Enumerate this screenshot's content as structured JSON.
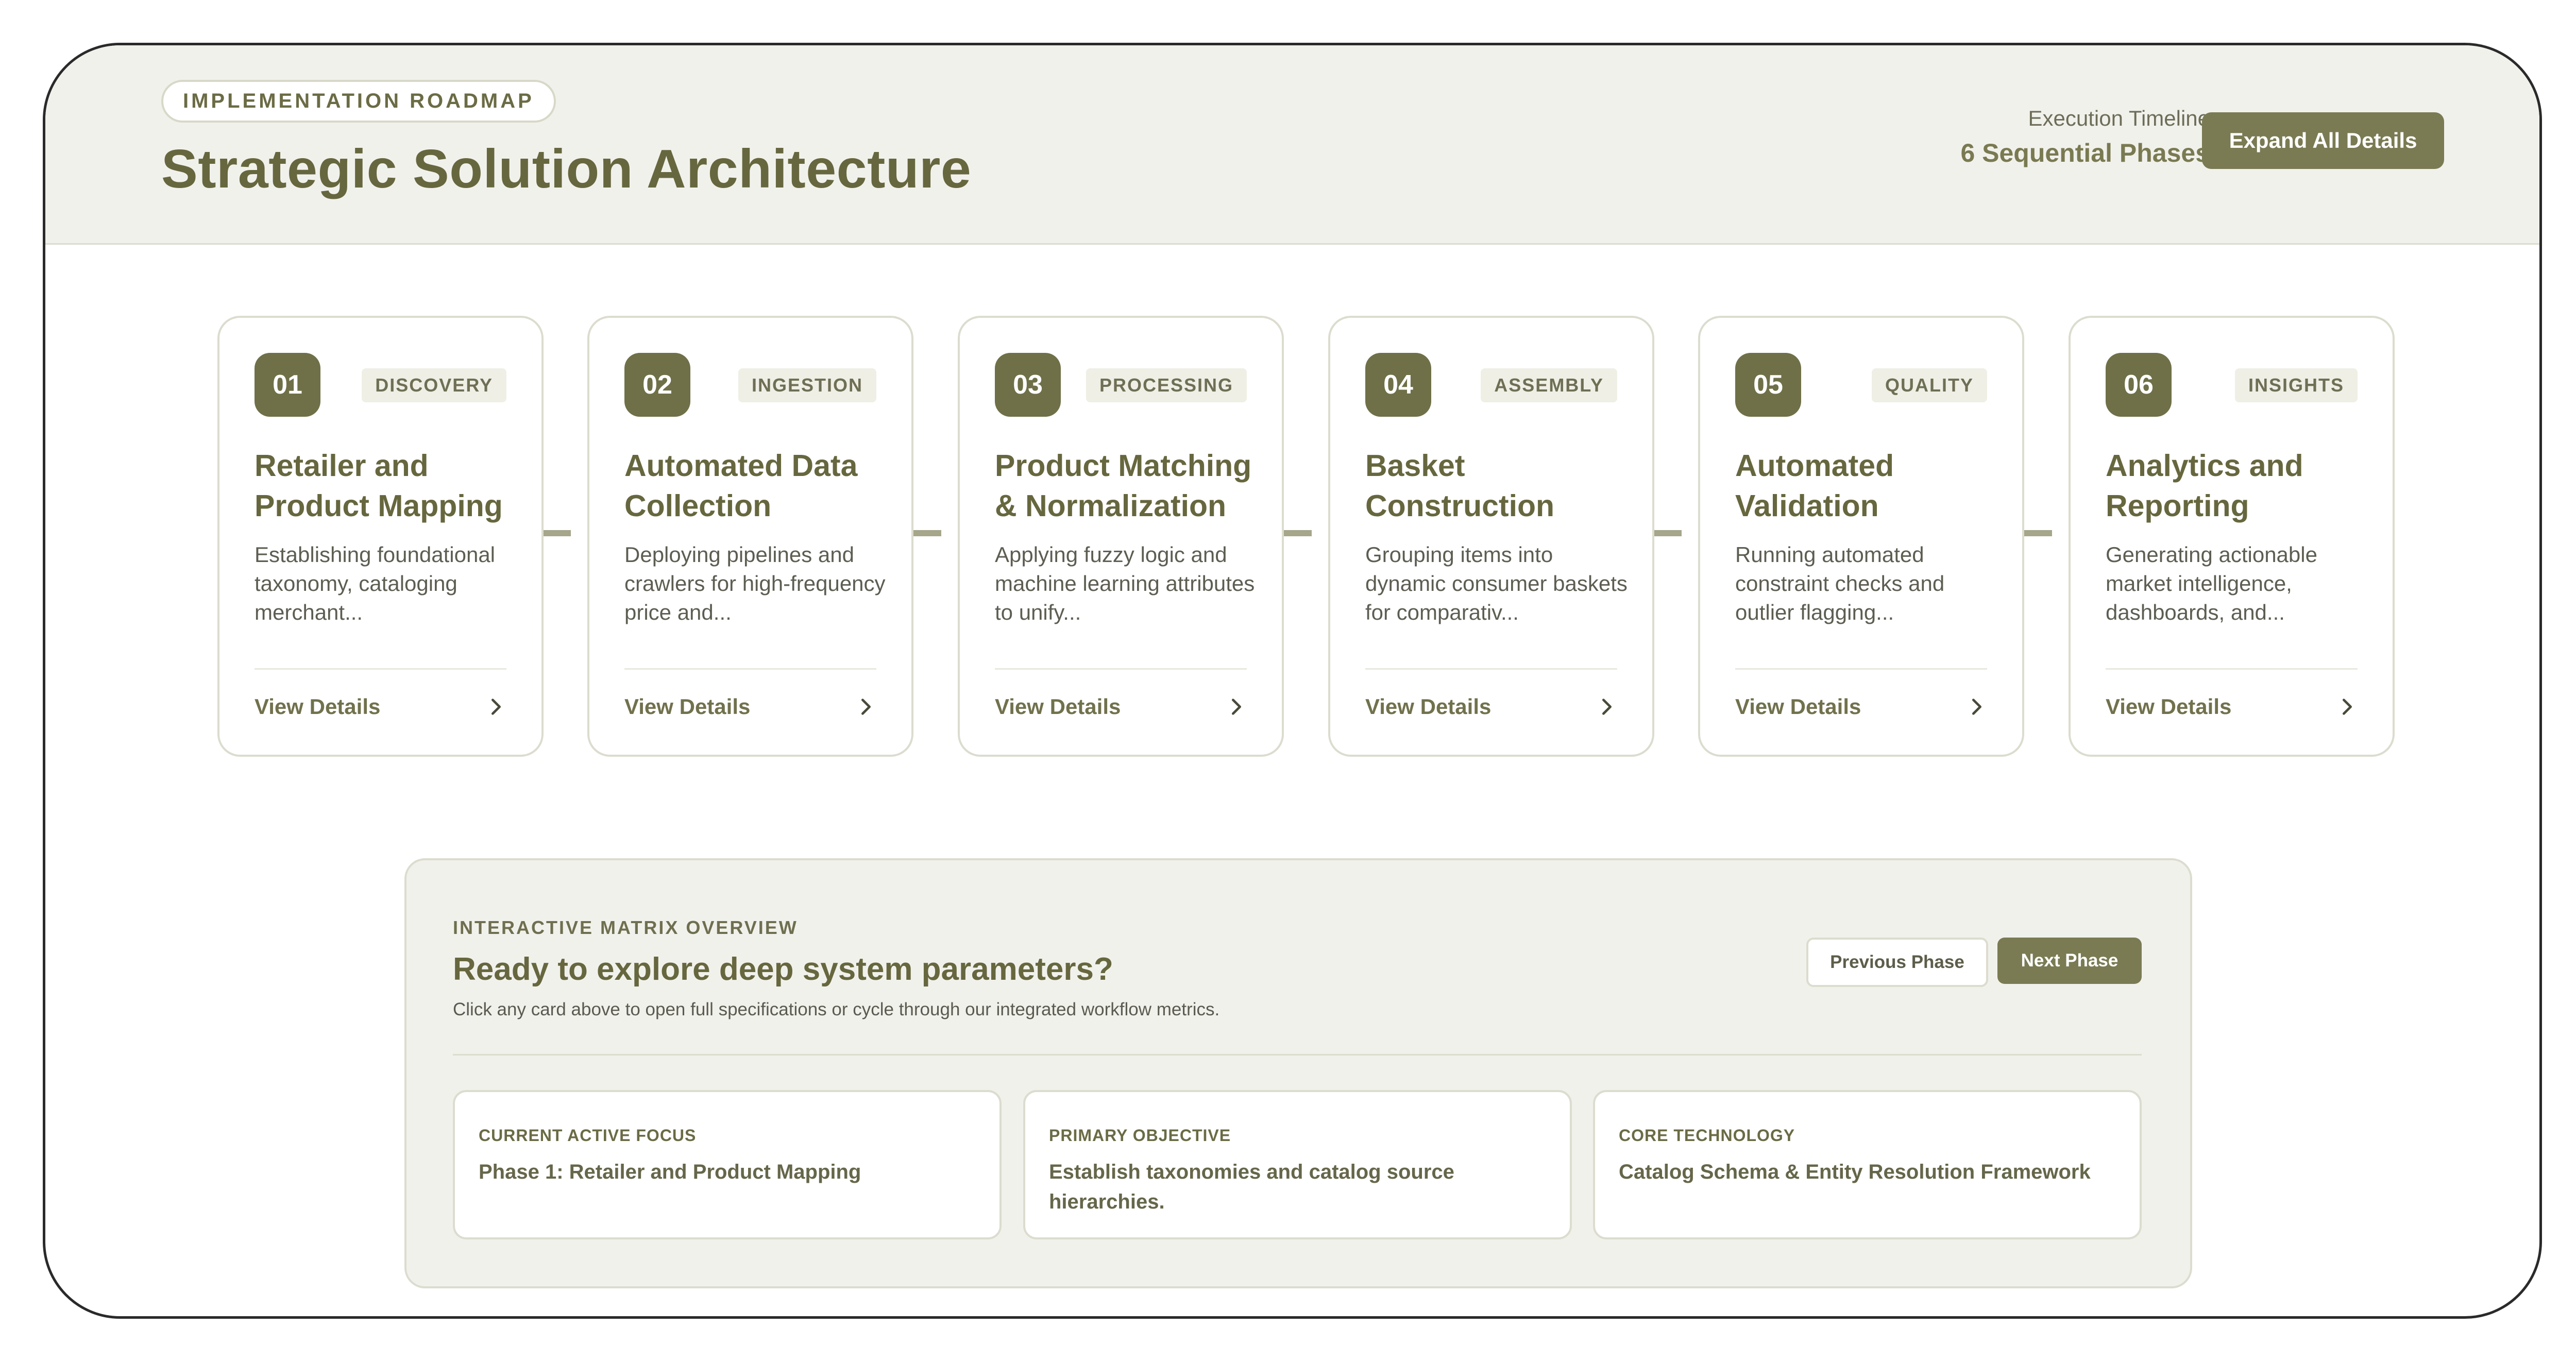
{
  "header": {
    "eyebrow": "IMPLEMENTATION ROADMAP",
    "title": "Strategic Solution Architecture",
    "timeline_label": "Execution Timeline",
    "timeline_value": "6 Sequential Phases",
    "expand_button": "Expand All Details"
  },
  "phases": [
    {
      "number": "01",
      "tag": "DISCOVERY",
      "title": "Retailer and Product Mapping",
      "description": "Establishing foundational taxonomy, cataloging merchant...",
      "link": "View Details"
    },
    {
      "number": "02",
      "tag": "INGESTION",
      "title": "Automated Data Collection",
      "description": "Deploying pipelines and crawlers for high-frequency price and...",
      "link": "View Details"
    },
    {
      "number": "03",
      "tag": "PROCESSING",
      "title": "Product Matching & Normalization",
      "description": "Applying fuzzy logic and machine learning attributes to unify...",
      "link": "View Details"
    },
    {
      "number": "04",
      "tag": "ASSEMBLY",
      "title": "Basket Construction",
      "description": "Grouping items into dynamic consumer baskets for comparativ...",
      "link": "View Details"
    },
    {
      "number": "05",
      "tag": "QUALITY",
      "title": "Automated Validation",
      "description": "Running automated constraint checks and outlier flagging...",
      "link": "View Details"
    },
    {
      "number": "06",
      "tag": "INSIGHTS",
      "title": "Analytics and Reporting",
      "description": "Generating actionable market intelligence, dashboards, and...",
      "link": "View Details"
    }
  ],
  "matrix": {
    "eyebrow": "INTERACTIVE MATRIX OVERVIEW",
    "title": "Ready to explore deep system parameters?",
    "subtitle": "Click any card above to open full specifications or cycle through our integrated workflow metrics.",
    "prev_button": "Previous Phase",
    "next_button": "Next Phase",
    "cards": [
      {
        "label": "CURRENT ACTIVE FOCUS",
        "value": "Phase 1: Retailer and Product Mapping"
      },
      {
        "label": "PRIMARY OBJECTIVE",
        "value": "Establish taxonomies and catalog source hierarchies."
      },
      {
        "label": "CORE TECHNOLOGY",
        "value": "Catalog Schema & Entity Resolution Framework"
      }
    ]
  },
  "colors": {
    "accent": "#7a7b53",
    "header_bg": "#f1f1ec",
    "border": "#dcdccf"
  },
  "icons": {
    "card_link": "chevron-right-icon"
  }
}
